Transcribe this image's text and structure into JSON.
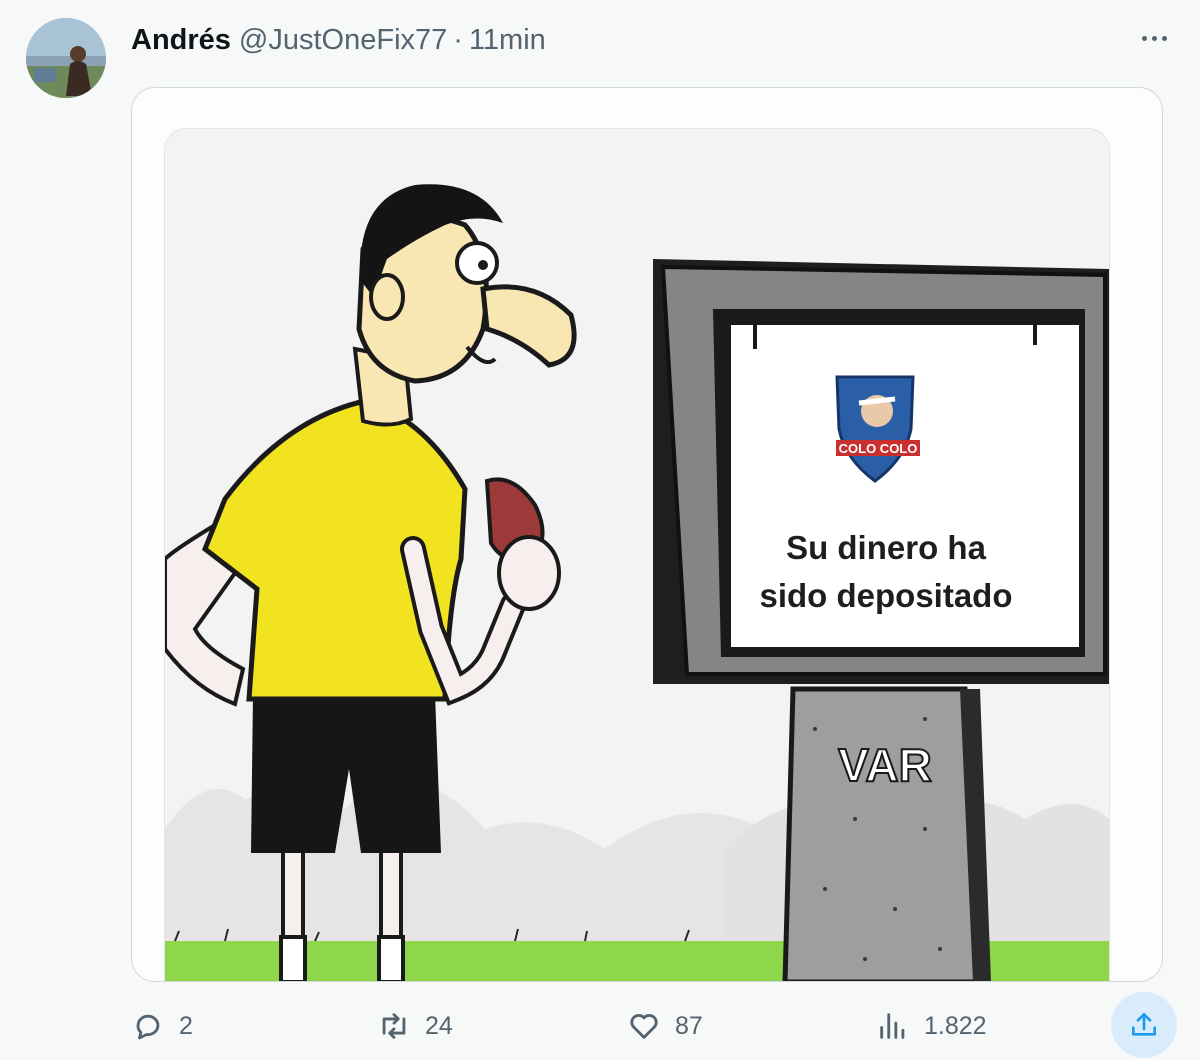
{
  "tweet": {
    "author_name": "Andrés",
    "author_handle": "@JustOneFix77",
    "separator": "·",
    "timestamp": "11min"
  },
  "meme": {
    "screen_line1": "Su dinero ha",
    "screen_line2": "sido depositado",
    "badge_text": "COLO COLO",
    "stand_label": "VAR"
  },
  "actions": {
    "reply_count": "2",
    "retweet_count": "24",
    "like_count": "87",
    "views_count": "1.822"
  },
  "icons": {
    "more": "more-dots-icon",
    "reply": "reply-icon",
    "retweet": "retweet-icon",
    "like": "heart-icon",
    "views": "views-icon",
    "share": "share-icon"
  },
  "colors": {
    "muted_text": "#536471",
    "share_accent": "#1d9bf0",
    "share_bg": "#d9ecfb",
    "card_border": "#cfd9de",
    "shirt_yellow": "#f2e321",
    "grass_green": "#8ed64a"
  }
}
